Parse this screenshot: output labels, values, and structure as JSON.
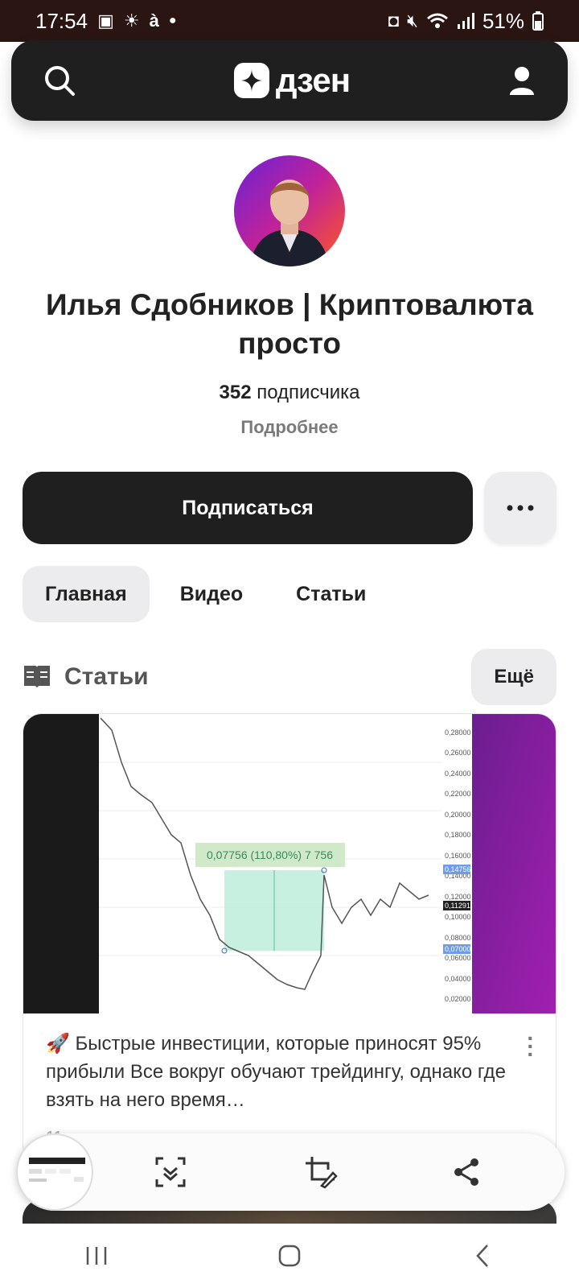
{
  "status_bar": {
    "time": "17:54",
    "battery": "51%"
  },
  "header": {
    "logo_text": "дзен"
  },
  "channel": {
    "title": "Илья Сдобников | Криптовалюта просто",
    "subscribers_count": "352",
    "subscribers_label": "подписчика",
    "details_link": "Подробнее",
    "subscribe_label": "Подписаться"
  },
  "tabs": [
    {
      "label": "Главная",
      "active": true
    },
    {
      "label": "Видео",
      "active": false
    },
    {
      "label": "Статьи",
      "active": false
    }
  ],
  "section": {
    "title": "Статьи",
    "more_label": "Ещё"
  },
  "article": {
    "text": "🚀 Быстрые инвестиции, которые приносят 95% прибыли Все вокруг обучают трейдингу, однако где взять на него время…",
    "time_ago": "11 часов назад",
    "chart_annotation": "0,07756 (110,80%) 7 756",
    "price_axis": [
      "0,28000",
      "0,26000",
      "0,24000",
      "0,22000",
      "0,20000",
      "0,18000",
      "0,16000",
      "0,14000",
      "0,12000",
      "0,10000",
      "0,08000",
      "0,06000",
      "0,04000",
      "0,02000"
    ],
    "highlight_top": "0,14756",
    "highlight_current": "0,11291",
    "highlight_bottom": "0,07000"
  },
  "colors": {
    "dark": "#1f1f1f",
    "status_bar": "#2a1513",
    "chip": "#ececef",
    "chart_zone": "#a8e6cf",
    "card_purple": "#8a1fa8"
  }
}
